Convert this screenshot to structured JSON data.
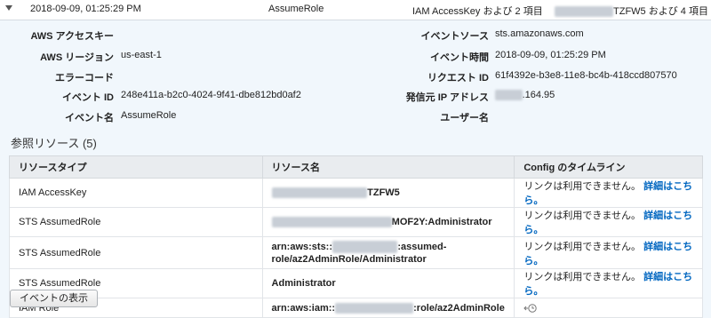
{
  "summary": {
    "time": "2018-09-09, 01:25:29 PM",
    "event_name": "AssumeRole",
    "resource_summary": "IAM AccessKey および 2 項目",
    "access_key_suffix": "TZFW5 および 4 項目"
  },
  "details": {
    "left": [
      {
        "label": "AWS アクセスキー",
        "value": ""
      },
      {
        "label": "AWS リージョン",
        "value": "us-east-1"
      },
      {
        "label": "エラーコード",
        "value": ""
      },
      {
        "label": "イベント ID",
        "value": "248e411a-b2c0-4024-9f41-dbe812bd0af2"
      },
      {
        "label": "イベント名",
        "value": "AssumeRole"
      }
    ],
    "right": [
      {
        "label": "イベントソース",
        "value": "sts.amazonaws.com"
      },
      {
        "label": "イベント時間",
        "value": "2018-09-09, 01:25:29 PM"
      },
      {
        "label": "リクエスト ID",
        "value": "61f4392e-b3e8-11e8-bc4b-418ccd807570"
      },
      {
        "label": "発信元 IP アドレス",
        "value": ".164.95"
      },
      {
        "label": "ユーザー名",
        "value": ""
      }
    ]
  },
  "resources": {
    "title": "参照リソース (5)",
    "headers": [
      "リソースタイプ",
      "リソース名",
      "Config のタイムライン"
    ],
    "rows": [
      {
        "type": "IAM AccessKey",
        "name_suffix": "TZFW5",
        "config_text": "リンクは利用できません。",
        "config_link": "詳細はこちら。"
      },
      {
        "type": "STS AssumedRole",
        "name_suffix": "MOF2Y:Administrator",
        "config_text": "リンクは利用できません。",
        "config_link": "詳細はこちら。"
      },
      {
        "type": "STS AssumedRole",
        "name_prefix": "arn:aws:sts::",
        "name_suffix": ":assumed-",
        "name_line2": "role/az2AdminRole/Administrator",
        "config_text": "リンクは利用できません。",
        "config_link": "詳細はこちら。"
      },
      {
        "type": "STS AssumedRole",
        "name_full": "Administrator",
        "config_text": "リンクは利用できません。",
        "config_link": "詳細はこちら。"
      },
      {
        "type": "IAM Role",
        "name_prefix": "arn:aws:iam::",
        "name_suffix": ":role/az2AdminRole",
        "config_icon": "timeline-clock-icon"
      }
    ]
  },
  "actions": {
    "view_event": "イベントの表示"
  },
  "colors": {
    "background": "#f1f7fc",
    "link": "#0066c0",
    "header_bg": "#e9ecef"
  }
}
